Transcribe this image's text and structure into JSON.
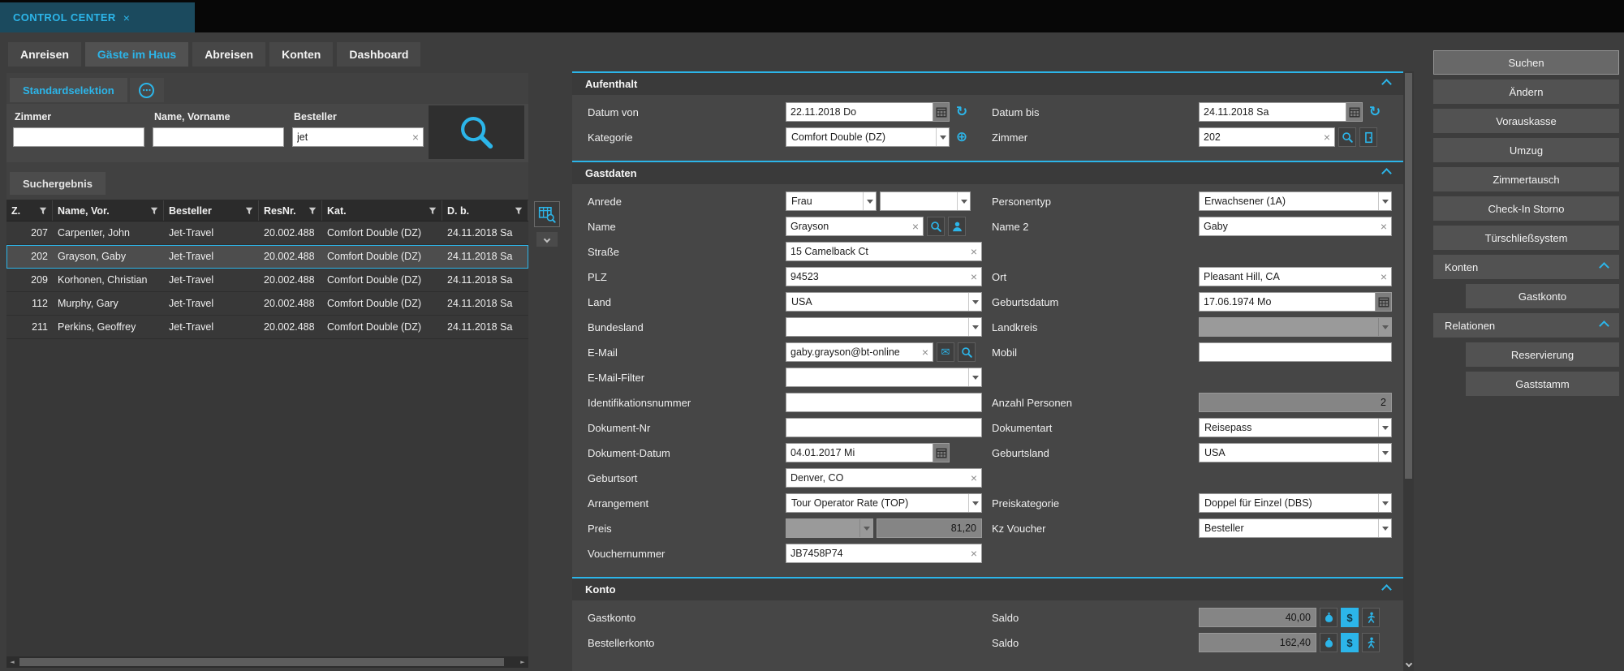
{
  "window": {
    "title": "CONTROL CENTER",
    "close_glyph": "×"
  },
  "icons": {
    "refresh": "↻",
    "circled_plus": "⊕",
    "envelope": "✉",
    "clear": "×",
    "dots": "⋯",
    "dollar": "$",
    "scroll_left": "◄",
    "scroll_right": "►"
  },
  "main_tabs": [
    {
      "label": "Anreisen"
    },
    {
      "label": "Gäste im Haus"
    },
    {
      "label": "Abreisen"
    },
    {
      "label": "Konten"
    },
    {
      "label": "Dashboard"
    }
  ],
  "left_panel": {
    "selection_tab": "Standardselektion",
    "results_tab": "Suchergebnis",
    "criteria": [
      {
        "label": "Zimmer",
        "value": ""
      },
      {
        "label": "Name, Vorname",
        "value": ""
      },
      {
        "label": "Besteller",
        "value": "jet"
      }
    ],
    "table": {
      "columns": [
        "Z.",
        "Name, Vor.",
        "Besteller",
        "ResNr.",
        "Kat.",
        "D. b."
      ],
      "rows": [
        {
          "z": "207",
          "name": "Carpenter, John",
          "besteller": "Jet-Travel",
          "resnr": "20.002.488",
          "kat": "Comfort Double (DZ)",
          "db": "24.11.2018 Sa"
        },
        {
          "z": "202",
          "name": "Grayson, Gaby",
          "besteller": "Jet-Travel",
          "resnr": "20.002.488",
          "kat": "Comfort Double (DZ)",
          "db": "24.11.2018 Sa"
        },
        {
          "z": "209",
          "name": "Korhonen, Christian",
          "besteller": "Jet-Travel",
          "resnr": "20.002.488",
          "kat": "Comfort Double (DZ)",
          "db": "24.11.2018 Sa"
        },
        {
          "z": "112",
          "name": "Murphy, Gary",
          "besteller": "Jet-Travel",
          "resnr": "20.002.488",
          "kat": "Comfort Double (DZ)",
          "db": "24.11.2018 Sa"
        },
        {
          "z": "211",
          "name": "Perkins, Geoffrey",
          "besteller": "Jet-Travel",
          "resnr": "20.002.488",
          "kat": "Comfort Double (DZ)",
          "db": "24.11.2018 Sa"
        }
      ]
    }
  },
  "form": {
    "aufenthalt": {
      "title": "Aufenthalt",
      "datum_von": {
        "label": "Datum von",
        "value": "22.11.2018 Do"
      },
      "datum_bis": {
        "label": "Datum bis",
        "value": "24.11.2018 Sa"
      },
      "kategorie": {
        "label": "Kategorie",
        "value": "Comfort Double (DZ)"
      },
      "zimmer": {
        "label": "Zimmer",
        "value": "202"
      }
    },
    "gastdaten": {
      "title": "Gastdaten",
      "anrede": {
        "label": "Anrede",
        "value": "Frau",
        "value2": ""
      },
      "personentyp": {
        "label": "Personentyp",
        "value": "Erwachsener (1A)"
      },
      "name": {
        "label": "Name",
        "value": "Grayson"
      },
      "name2": {
        "label": "Name 2",
        "value": "Gaby"
      },
      "strasse": {
        "label": "Straße",
        "value": "15 Camelback Ct"
      },
      "plz": {
        "label": "PLZ",
        "value": "94523"
      },
      "ort": {
        "label": "Ort",
        "value": "Pleasant Hill, CA"
      },
      "land": {
        "label": "Land",
        "value": "USA"
      },
      "geburtsdatum": {
        "label": "Geburtsdatum",
        "value": "17.06.1974 Mo"
      },
      "bundesland": {
        "label": "Bundesland",
        "value": ""
      },
      "landkreis": {
        "label": "Landkreis",
        "value": ""
      },
      "email": {
        "label": "E-Mail",
        "value": "gaby.grayson@bt-online"
      },
      "mobil": {
        "label": "Mobil",
        "value": ""
      },
      "email_filter": {
        "label": "E-Mail-Filter",
        "value": ""
      },
      "identifikationsnummer": {
        "label": "Identifikationsnummer",
        "value": ""
      },
      "anzahl_personen": {
        "label": "Anzahl Personen",
        "value": "2"
      },
      "dokument_nr": {
        "label": "Dokument-Nr",
        "value": ""
      },
      "dokumentart": {
        "label": "Dokumentart",
        "value": "Reisepass"
      },
      "dokument_datum": {
        "label": "Dokument-Datum",
        "value": "04.01.2017 Mi"
      },
      "geburtsland": {
        "label": "Geburtsland",
        "value": "USA"
      },
      "geburtsort": {
        "label": "Geburtsort",
        "value": "Denver, CO"
      },
      "arrangement": {
        "label": "Arrangement",
        "value": "Tour Operator Rate (TOP)"
      },
      "preiskategorie": {
        "label": "Preiskategorie",
        "value": "Doppel für Einzel (DBS)"
      },
      "preis": {
        "label": "Preis",
        "value": "81,20",
        "currency_value": ""
      },
      "kz_voucher": {
        "label": "Kz Voucher",
        "value": "Besteller"
      },
      "vouchernummer": {
        "label": "Vouchernummer",
        "value": "JB7458P74"
      }
    },
    "konto": {
      "title": "Konto",
      "gastkonto": {
        "label": "Gastkonto",
        "saldo_label": "Saldo",
        "value": "40,00"
      },
      "bestellerkonto": {
        "label": "Bestellerkonto",
        "saldo_label": "Saldo",
        "value": "162,40"
      }
    }
  },
  "right_panel": {
    "buttons": [
      "Suchen",
      "Ändern",
      "Vorauskasse",
      "Umzug",
      "Zimmertausch",
      "Check-In Storno",
      "Türschließsystem"
    ],
    "konten": {
      "header": "Konten",
      "items": [
        "Gastkonto"
      ]
    },
    "relationen": {
      "header": "Relationen",
      "items": [
        "Reservierung",
        "Gaststamm"
      ]
    }
  }
}
